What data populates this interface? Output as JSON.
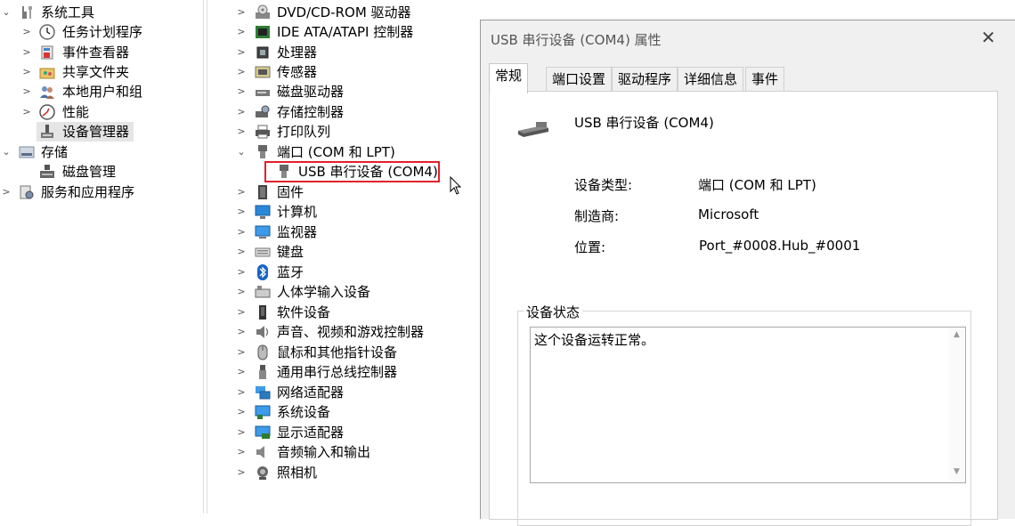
{
  "left_tree": [
    {
      "label": "系统工具",
      "chevron": "⌄",
      "icon": "tools-icon",
      "depth": 0
    },
    {
      "label": "任务计划程序",
      "chevron": ">",
      "icon": "clock-icon",
      "depth": 1
    },
    {
      "label": "事件查看器",
      "chevron": ">",
      "icon": "event-viewer-icon",
      "depth": 1
    },
    {
      "label": "共享文件夹",
      "chevron": ">",
      "icon": "shared-folder-icon",
      "depth": 1
    },
    {
      "label": "本地用户和组",
      "chevron": ">",
      "icon": "users-icon",
      "depth": 1
    },
    {
      "label": "性能",
      "chevron": ">",
      "icon": "performance-icon",
      "depth": 1
    },
    {
      "label": "设备管理器",
      "chevron": "",
      "icon": "device-manager-icon",
      "depth": 1,
      "selected": true
    },
    {
      "label": "存储",
      "chevron": "⌄",
      "icon": "storage-icon",
      "depth": 0
    },
    {
      "label": "磁盘管理",
      "chevron": "",
      "icon": "disk-management-icon",
      "depth": 1
    },
    {
      "label": "服务和应用程序",
      "chevron": ">",
      "icon": "services-icon",
      "depth": 0
    }
  ],
  "device_tree": [
    {
      "label": "DVD/CD-ROM 驱动器",
      "chevron": ">",
      "icon": "dvd-icon"
    },
    {
      "label": "IDE ATA/ATAPI 控制器",
      "chevron": ">",
      "icon": "ide-controller-icon"
    },
    {
      "label": "处理器",
      "chevron": ">",
      "icon": "processor-icon"
    },
    {
      "label": "传感器",
      "chevron": ">",
      "icon": "sensor-icon"
    },
    {
      "label": "磁盘驱动器",
      "chevron": ">",
      "icon": "disk-drive-icon"
    },
    {
      "label": "存储控制器",
      "chevron": ">",
      "icon": "storage-controller-icon"
    },
    {
      "label": "打印队列",
      "chevron": ">",
      "icon": "printer-icon"
    },
    {
      "label": "端口 (COM 和 LPT)",
      "chevron": "⌄",
      "icon": "port-icon"
    },
    {
      "label": "USB 串行设备 (COM4)",
      "chevron": "",
      "icon": "port-icon",
      "child": true
    },
    {
      "label": "固件",
      "chevron": ">",
      "icon": "firmware-icon"
    },
    {
      "label": "计算机",
      "chevron": ">",
      "icon": "computer-icon"
    },
    {
      "label": "监视器",
      "chevron": ">",
      "icon": "monitor-icon"
    },
    {
      "label": "键盘",
      "chevron": ">",
      "icon": "keyboard-icon"
    },
    {
      "label": "蓝牙",
      "chevron": ">",
      "icon": "bluetooth-icon"
    },
    {
      "label": "人体学输入设备",
      "chevron": ">",
      "icon": "hid-icon"
    },
    {
      "label": "软件设备",
      "chevron": ">",
      "icon": "software-device-icon"
    },
    {
      "label": "声音、视频和游戏控制器",
      "chevron": ">",
      "icon": "speaker-icon"
    },
    {
      "label": "鼠标和其他指针设备",
      "chevron": ">",
      "icon": "mouse-icon"
    },
    {
      "label": "通用串行总线控制器",
      "chevron": ">",
      "icon": "usb-icon"
    },
    {
      "label": "网络适配器",
      "chevron": ">",
      "icon": "network-adapter-icon"
    },
    {
      "label": "系统设备",
      "chevron": ">",
      "icon": "system-device-icon"
    },
    {
      "label": "显示适配器",
      "chevron": ">",
      "icon": "display-adapter-icon"
    },
    {
      "label": "音频输入和输出",
      "chevron": ">",
      "icon": "audio-io-icon"
    },
    {
      "label": "照相机",
      "chevron": ">",
      "icon": "camera-icon"
    }
  ],
  "dialog": {
    "title": "USB 串行设备 (COM4) 属性",
    "close": "✕",
    "tabs": [
      "常规",
      "端口设置",
      "驱动程序",
      "详细信息",
      "事件"
    ],
    "active_tab": "常规",
    "device_name": "USB 串行设备 (COM4)",
    "properties": [
      {
        "key": "设备类型:",
        "value": "端口 (COM 和 LPT)"
      },
      {
        "key": "制造商:",
        "value": "Microsoft"
      },
      {
        "key": "位置:",
        "value": "Port_#0008.Hub_#0001"
      }
    ],
    "status_legend": "设备状态",
    "status_text": "这个设备运转正常。"
  },
  "colors": {
    "highlight_border": "#e0202b",
    "selection_bg": "#e5e5e5",
    "dialog_bg": "#f0f0f0"
  }
}
